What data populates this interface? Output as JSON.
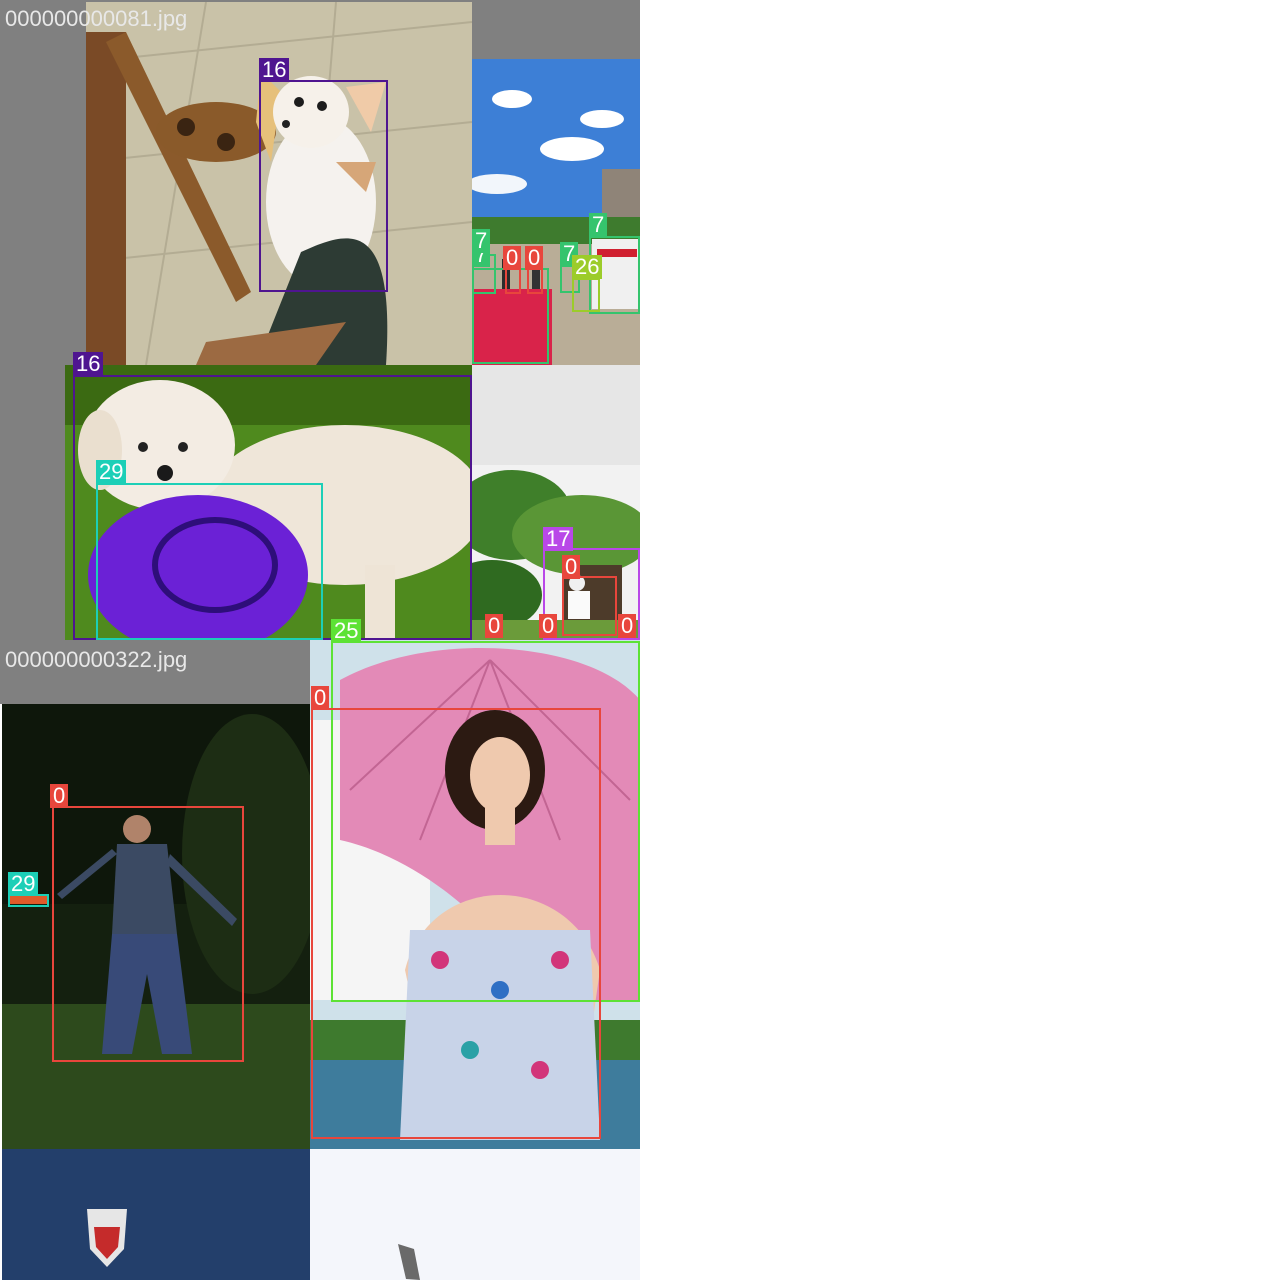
{
  "mosaic": {
    "tiles": [
      {
        "filename": "000000000081.jpg"
      },
      {
        "filename": "000000000322.jpg"
      }
    ]
  },
  "label_colors": {
    "0": "#e8463c",
    "7": "#35c46d",
    "16": "#4f1590",
    "17": "#b948e8",
    "25": "#5de235",
    "26": "#9ccc2a",
    "29": "#1ccfb7"
  },
  "detections": [
    {
      "class_id": "16",
      "scene": "chihuahua"
    },
    {
      "class_id": "7",
      "scene": "street"
    },
    {
      "class_id": "7",
      "scene": "street"
    },
    {
      "class_id": "7",
      "scene": "street"
    },
    {
      "class_id": "7",
      "scene": "street"
    },
    {
      "class_id": "0",
      "scene": "street"
    },
    {
      "class_id": "0",
      "scene": "street"
    },
    {
      "class_id": "26",
      "scene": "street"
    },
    {
      "class_id": "16",
      "scene": "poodle"
    },
    {
      "class_id": "29",
      "scene": "poodle"
    },
    {
      "class_id": "17",
      "scene": "park"
    },
    {
      "class_id": "0",
      "scene": "park"
    },
    {
      "class_id": "0",
      "scene": "park"
    },
    {
      "class_id": "0",
      "scene": "park"
    },
    {
      "class_id": "0",
      "scene": "park"
    },
    {
      "class_id": "0",
      "scene": "night-yard"
    },
    {
      "class_id": "29",
      "scene": "night-yard"
    },
    {
      "class_id": "25",
      "scene": "umbrella"
    },
    {
      "class_id": "0",
      "scene": "umbrella"
    }
  ]
}
